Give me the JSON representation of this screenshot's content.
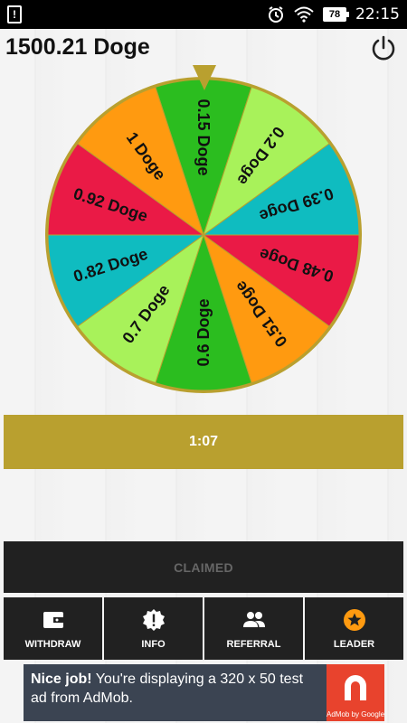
{
  "status_bar": {
    "alert_icon": "exclamation",
    "battery_level": "78",
    "time": "22:15",
    "icons": [
      "alarm-clock-icon",
      "wifi-icon",
      "battery-icon"
    ]
  },
  "header": {
    "balance": "1500.21 Doge",
    "power_icon": "power-icon"
  },
  "wheel": {
    "segments": [
      {
        "label": "0.15 Doge",
        "color": "#2bbd1f"
      },
      {
        "label": "0.2 Doge",
        "color": "#a8f25a"
      },
      {
        "label": "0.39 Doge",
        "color": "#0fbcc0"
      },
      {
        "label": "0.48 Doge",
        "color": "#ea1a46"
      },
      {
        "label": "0.51 Doge",
        "color": "#ff9a10"
      },
      {
        "label": "0.6 Doge",
        "color": "#2bbd1f"
      },
      {
        "label": "0.7 Doge",
        "color": "#a8f25a"
      },
      {
        "label": "0.82 Doge",
        "color": "#0fbcc0"
      },
      {
        "label": "0.92 Doge",
        "color": "#ea1a46"
      },
      {
        "label": "1 Doge",
        "color": "#ff9a10"
      }
    ],
    "rim_color": "#b9a02f"
  },
  "timer": {
    "value": "1:07"
  },
  "claim": {
    "label": "CLAIMED"
  },
  "nav": {
    "items": [
      {
        "label": "WITHDRAW",
        "icon": "wallet-icon"
      },
      {
        "label": "INFO",
        "icon": "info-badge-icon"
      },
      {
        "label": "REFERRAL",
        "icon": "people-icon"
      },
      {
        "label": "LEADER",
        "icon": "star-icon"
      }
    ]
  },
  "ad": {
    "headline": "Nice job!",
    "body": " You're displaying a 320 x 50 test ad from AdMob.",
    "caption": "AdMob by Google"
  }
}
